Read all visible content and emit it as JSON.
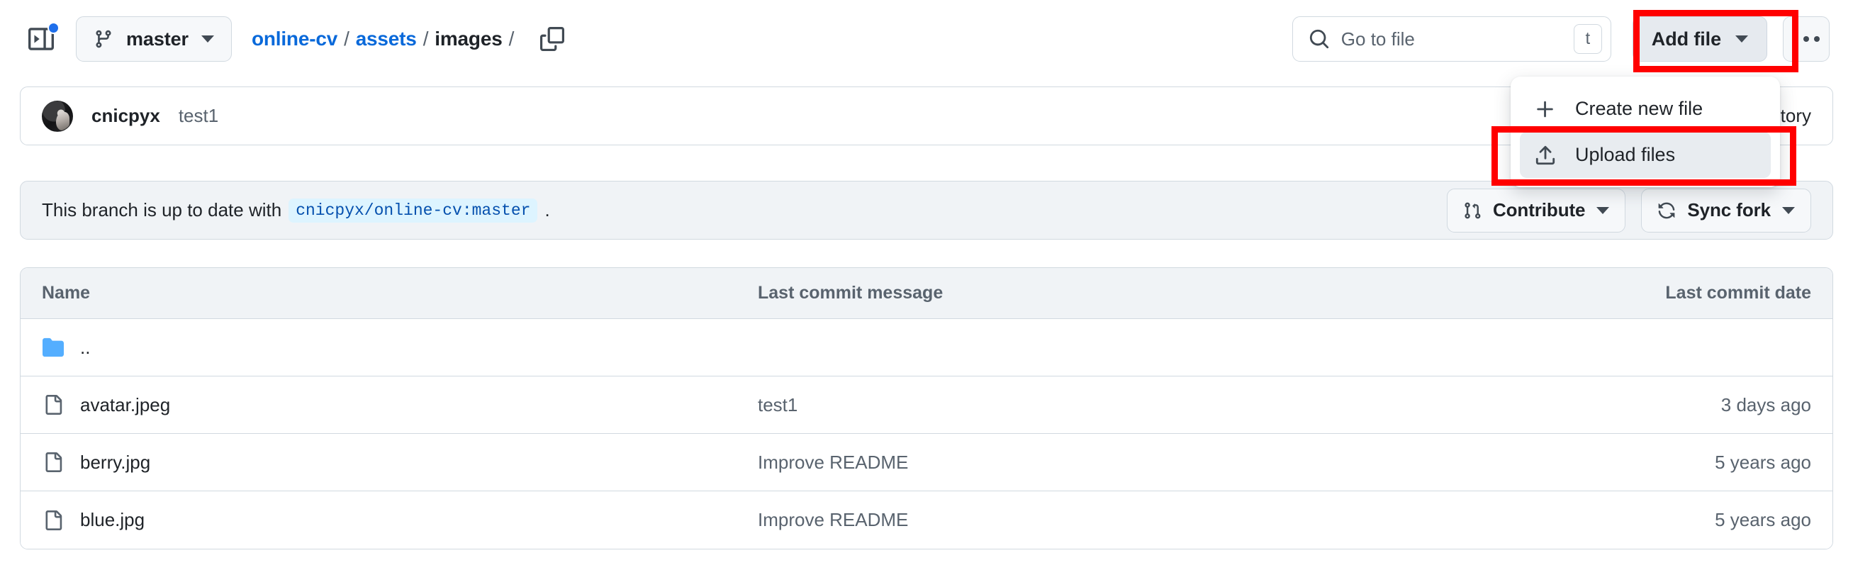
{
  "header": {
    "sidebar_toggle_icon": "sidebar-expand-icon",
    "notification_dot_color": "#1f6feb",
    "branch": {
      "icon": "git-branch-icon",
      "name": "master",
      "caret_icon": "chevron-down-icon"
    },
    "breadcrumb": {
      "repo": "online-cv",
      "segments": [
        "assets",
        "images"
      ],
      "separator": "/",
      "trailing_separator": "/",
      "copy_path_icon": "copy-icon"
    },
    "search": {
      "icon": "search-icon",
      "placeholder": "Go to file",
      "value": "",
      "shortcut_key": "t"
    },
    "add_file": {
      "label": "Add file",
      "caret_icon": "chevron-down-icon",
      "state": "active"
    },
    "kebab": {
      "icon": "kebab-horizontal-icon"
    }
  },
  "add_file_menu": {
    "items": [
      {
        "label": "Create new file",
        "icon": "plus-icon",
        "active": false
      },
      {
        "label": "Upload files",
        "icon": "upload-icon",
        "active": true
      }
    ]
  },
  "commit_bar": {
    "avatar_icon": "user-avatar",
    "author": "cnicpyx",
    "message": "test1",
    "history_label": "History"
  },
  "branch_status": {
    "text_before": "This branch is up to date with",
    "ref": "cnicpyx/online-cv:master",
    "text_after": ".",
    "contribute": {
      "label": "Contribute",
      "icon": "git-pull-request-icon",
      "caret_icon": "chevron-down-icon"
    },
    "sync_fork": {
      "label": "Sync fork",
      "icon": "sync-icon",
      "caret_icon": "chevron-down-icon"
    }
  },
  "file_table": {
    "columns": [
      "Name",
      "Last commit message",
      "Last commit date"
    ],
    "rows": [
      {
        "icon": "folder-icon",
        "type": "dir",
        "name": "..",
        "message": "",
        "date": ""
      },
      {
        "icon": "file-icon",
        "type": "file",
        "name": "avatar.jpeg",
        "message": "test1",
        "date": "3 days ago"
      },
      {
        "icon": "file-icon",
        "type": "file",
        "name": "berry.jpg",
        "message": "Improve README",
        "date": "5 years ago"
      },
      {
        "icon": "file-icon",
        "type": "file",
        "name": "blue.jpg",
        "message": "Improve README",
        "date": "5 years ago"
      }
    ]
  },
  "annotations": {
    "highlight_color": "#ff0000",
    "boxes": [
      "add-file-button",
      "upload-files-menu-item"
    ]
  },
  "colors": {
    "link": "#0969da",
    "text": "#1f2328",
    "muted": "#59636e",
    "border": "#d1d9e0",
    "canvas_subtle": "#f6f8fa",
    "header_bg": "#f0f3f6",
    "folder_blue": "#54aeff",
    "accent_ref_bg": "#ddf4ff"
  }
}
